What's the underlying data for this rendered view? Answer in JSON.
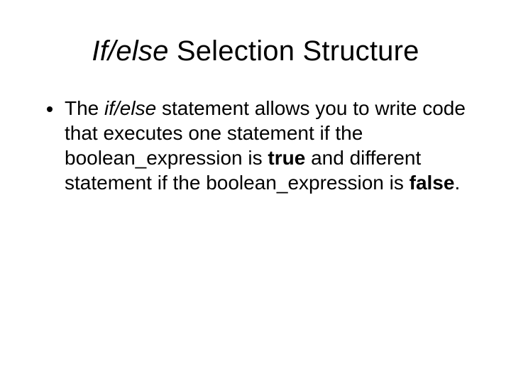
{
  "title": {
    "italic": "If/else",
    "rest": " Selection Structure"
  },
  "bullet": {
    "t1": "The ",
    "t2_italic": "if/else",
    "t3": " statement allows you to write code that executes one statement if the boolean_expression is ",
    "t4_bold": "true",
    "t5": " and different statement if the boolean_expression is ",
    "t6_bold": "false",
    "t7": "."
  }
}
